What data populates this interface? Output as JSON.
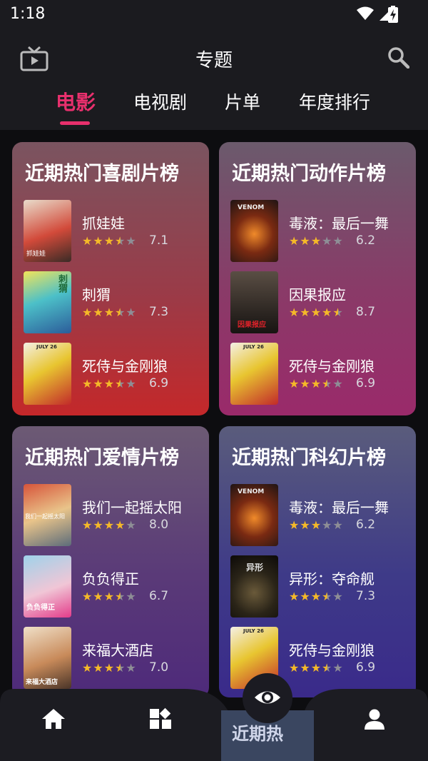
{
  "status_bar": {
    "time": "1:18"
  },
  "header": {
    "title": "专题"
  },
  "tabs": [
    "电影",
    "电视剧",
    "片单",
    "年度排行"
  ],
  "cards": [
    {
      "title": "近期热门喜剧片榜",
      "items": [
        {
          "name": "抓娃娃",
          "score": "7.1",
          "stars": 3.5
        },
        {
          "name": "刺猬",
          "score": "7.3",
          "stars": 3.5
        },
        {
          "name": "死侍与金刚狼",
          "score": "6.9",
          "stars": 3.5
        }
      ]
    },
    {
      "title": "近期热门动作片榜",
      "items": [
        {
          "name": "毒液：最后一舞",
          "score": "6.2",
          "stars": 3
        },
        {
          "name": "因果报应",
          "score": "8.7",
          "stars": 4.5
        },
        {
          "name": "死侍与金刚狼",
          "score": "6.9",
          "stars": 3.5
        }
      ]
    },
    {
      "title": "近期热门爱情片榜",
      "items": [
        {
          "name": "我们一起摇太阳",
          "score": "8.0",
          "stars": 4
        },
        {
          "name": "负负得正",
          "score": "6.7",
          "stars": 3.5
        },
        {
          "name": "来福大酒店",
          "score": "7.0",
          "stars": 3.5
        }
      ]
    },
    {
      "title": "近期热门科幻片榜",
      "items": [
        {
          "name": "毒液：最后一舞",
          "score": "6.2",
          "stars": 3
        },
        {
          "name": "异形：夺命舰",
          "score": "7.3",
          "stars": 3.5
        },
        {
          "name": "死侍与金刚狼",
          "score": "6.9",
          "stars": 3.5
        }
      ]
    }
  ],
  "poster_texts": {
    "p00": "抓娃娃",
    "p01": "刺猬",
    "p02": "JULY 26",
    "p10": "VENOM",
    "p11": "因果报应",
    "p12": "JULY 26",
    "p20": "我们一起摇太阳",
    "p21": "负负得正",
    "p22": "来福大酒店",
    "p30": "VENOM",
    "p31": "异形",
    "p32": "JULY 26"
  },
  "bottom_nav": {
    "peek_text": "近期热"
  },
  "colors": {
    "accent": "#e8306d",
    "star": "#f5b928"
  }
}
